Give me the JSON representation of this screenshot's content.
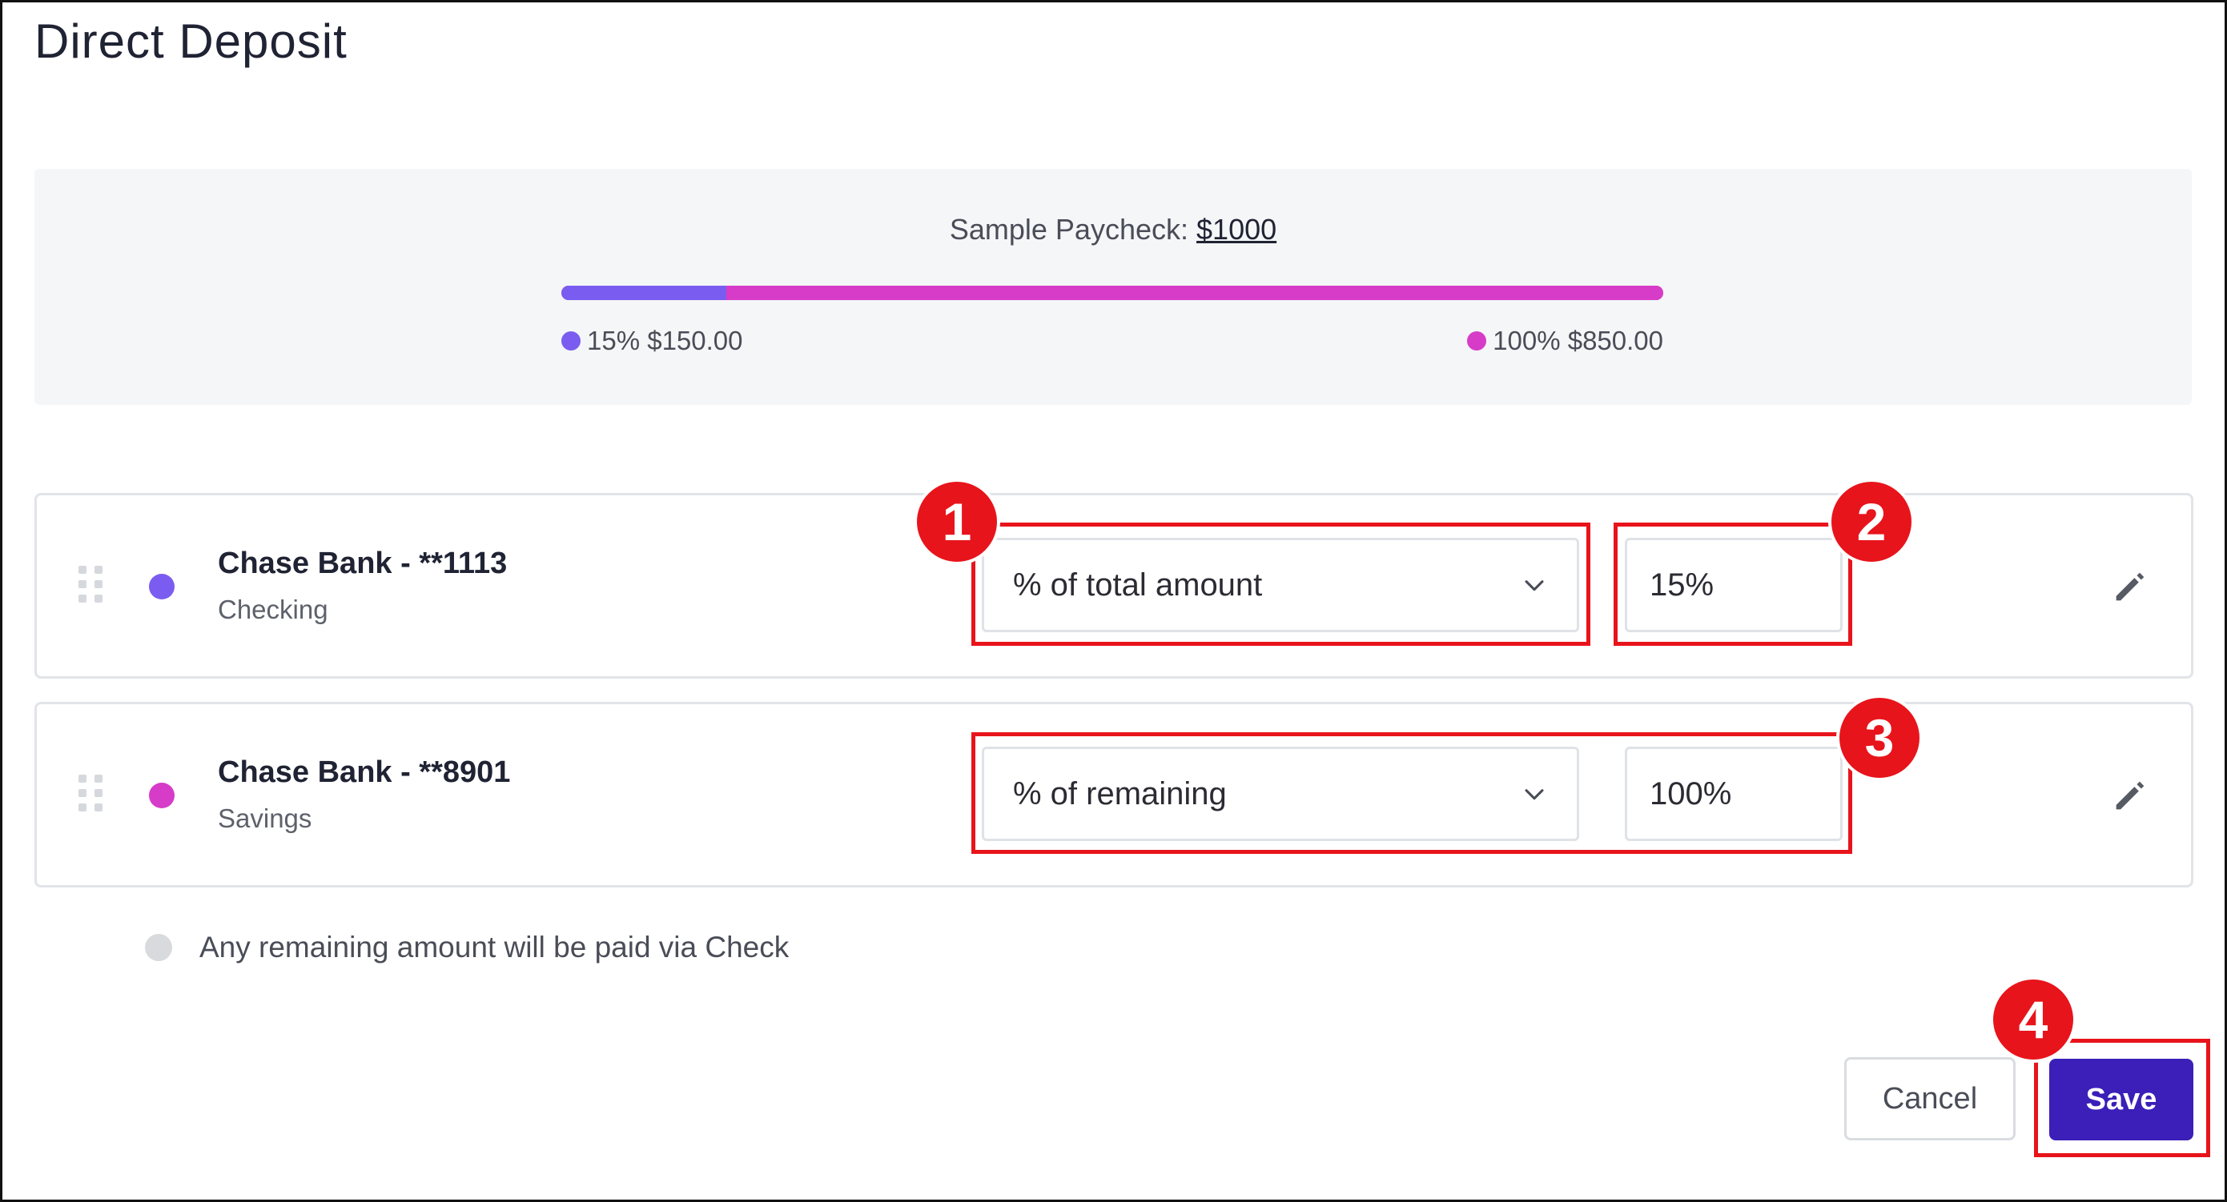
{
  "page": {
    "title": "Direct Deposit"
  },
  "paycheck": {
    "label": "Sample Paycheck:",
    "amount": "$1000",
    "allocations": [
      {
        "legend": "15% $150.00",
        "fraction": 0.15,
        "color": "#7b5cf0"
      },
      {
        "legend": "100% $850.00",
        "fraction": 0.85,
        "color": "#d63cc8"
      }
    ]
  },
  "accounts": [
    {
      "name": "Chase Bank - **1113",
      "type": "Checking",
      "dot_color": "#7b5cf0",
      "method": "% of total amount",
      "value": "15%",
      "drag_icon": "drag-handle-icon",
      "edit_icon": "pencil-icon"
    },
    {
      "name": "Chase Bank - **8901",
      "type": "Savings",
      "dot_color": "#d63cc8",
      "method": "% of remaining",
      "value": "100%",
      "drag_icon": "drag-handle-icon",
      "edit_icon": "pencil-icon"
    }
  ],
  "remaining_note": "Any remaining amount will be paid via Check",
  "buttons": {
    "cancel": "Cancel",
    "save": "Save"
  },
  "annotations": {
    "color": "#e8141b",
    "badges": [
      "1",
      "2",
      "3",
      "4"
    ]
  },
  "colors": {
    "brand": "#3b1fb8"
  }
}
